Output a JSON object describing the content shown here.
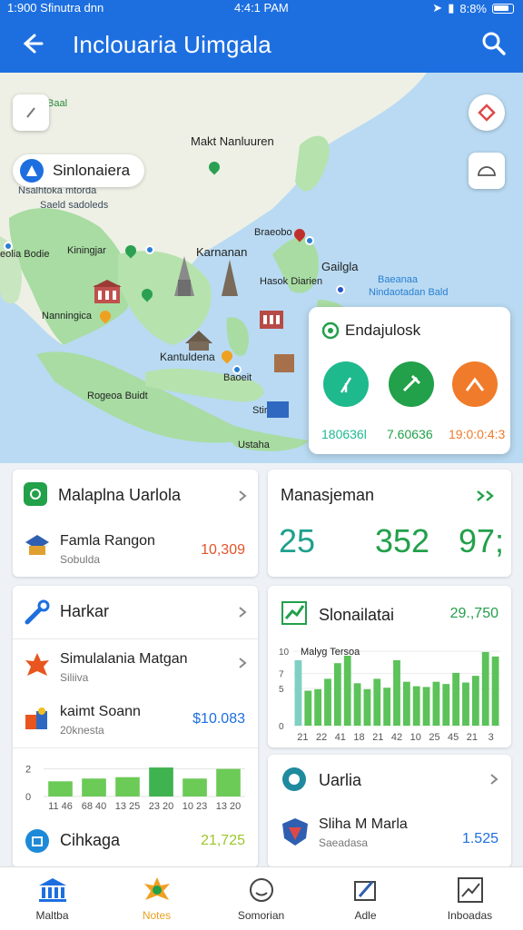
{
  "status_bar": {
    "left": "1:900 Sfinutra dnn",
    "time": "4:4:1 PAM",
    "battery": "8:8%"
  },
  "header": {
    "title": "Inclouaria Uimgala"
  },
  "colors": {
    "primary": "#1d6fe0",
    "green": "#22a04a",
    "orange": "#f07b2a",
    "teal": "#1fb98e",
    "red": "#e04848"
  },
  "map": {
    "search_chip": "Sinlonaiera",
    "labels": [
      "Baal",
      "Makt Nanluuren",
      "Nsalhtoka mtorda",
      "Saeld sadoleds",
      "eolia Bodie",
      "Kiningjar",
      "Karnanan",
      "Braeobo",
      "Hasok Diarien",
      "Gailgla",
      "Nanningica",
      "Kantuldena",
      "Rogeoa Buidt",
      "Baoeit",
      "Stirhed",
      "Ustaha",
      "Baeanaa",
      "Nindaotadan Bald"
    ],
    "popup": {
      "title": "Endajulosk",
      "values": [
        "180636l",
        "7.60636",
        "19:0:0:4:3"
      ]
    }
  },
  "cards": {
    "malaplna": {
      "title": "Malaplna Uarlola",
      "item_title": "Famla Rangon",
      "item_sub": "Sobulda",
      "item_value": "10,309"
    },
    "manajeman": {
      "title": "Manasjeman",
      "values": [
        "25",
        "352",
        "97;"
      ]
    },
    "harkar": {
      "title": "Harkar",
      "item1_title": "Simulalania Matgan",
      "item1_sub": "Siliiva",
      "item2_title": "kaimt Soann",
      "item2_sub": "20knesta",
      "item2_value": "$10.083",
      "item3_title": "Cihkaga",
      "item3_value": "21,725"
    },
    "slonailatai": {
      "title": "Slonailatai",
      "value": "29.,750",
      "chart_title": "Malyg Tersoa"
    },
    "uaria": {
      "title": "Uarlia",
      "item_title": "Sliha M Marla",
      "item_sub": "Saeadasa",
      "item_value": "1.525"
    }
  },
  "chart_data": [
    {
      "type": "bar",
      "title": "",
      "categories": [
        "11 46",
        "68 40",
        "13 25",
        "23 20",
        "10 23",
        "13 20"
      ],
      "values": [
        1.1,
        1.3,
        1.4,
        2.1,
        1.3,
        2.0
      ],
      "ylim": [
        0,
        2.5
      ],
      "ytick_labels": [
        "0",
        "2"
      ],
      "xlabel": "",
      "ylabel": ""
    },
    {
      "type": "bar",
      "title": "Malyg Tersoa",
      "categories": [
        "21",
        "22",
        "41",
        "18",
        "21",
        "42",
        "10",
        "25",
        "45",
        "21",
        "3"
      ],
      "values": [
        8.8,
        4.7,
        4.9,
        6.3,
        8.4,
        9.4,
        5.7,
        4.9,
        6.3,
        5.1,
        8.8,
        5.9,
        5.3,
        5.2,
        5.9,
        5.6,
        7.1,
        5.8,
        6.7,
        9.9,
        9.3
      ],
      "ylim": [
        0,
        10.5
      ],
      "ytick_labels": [
        "0",
        "5",
        "7",
        "10"
      ],
      "xlabel": "",
      "ylabel": ""
    }
  ],
  "nav": {
    "items": [
      "Maltba",
      "Notes",
      "Somorian",
      "Adle",
      "Inboadas"
    ]
  }
}
